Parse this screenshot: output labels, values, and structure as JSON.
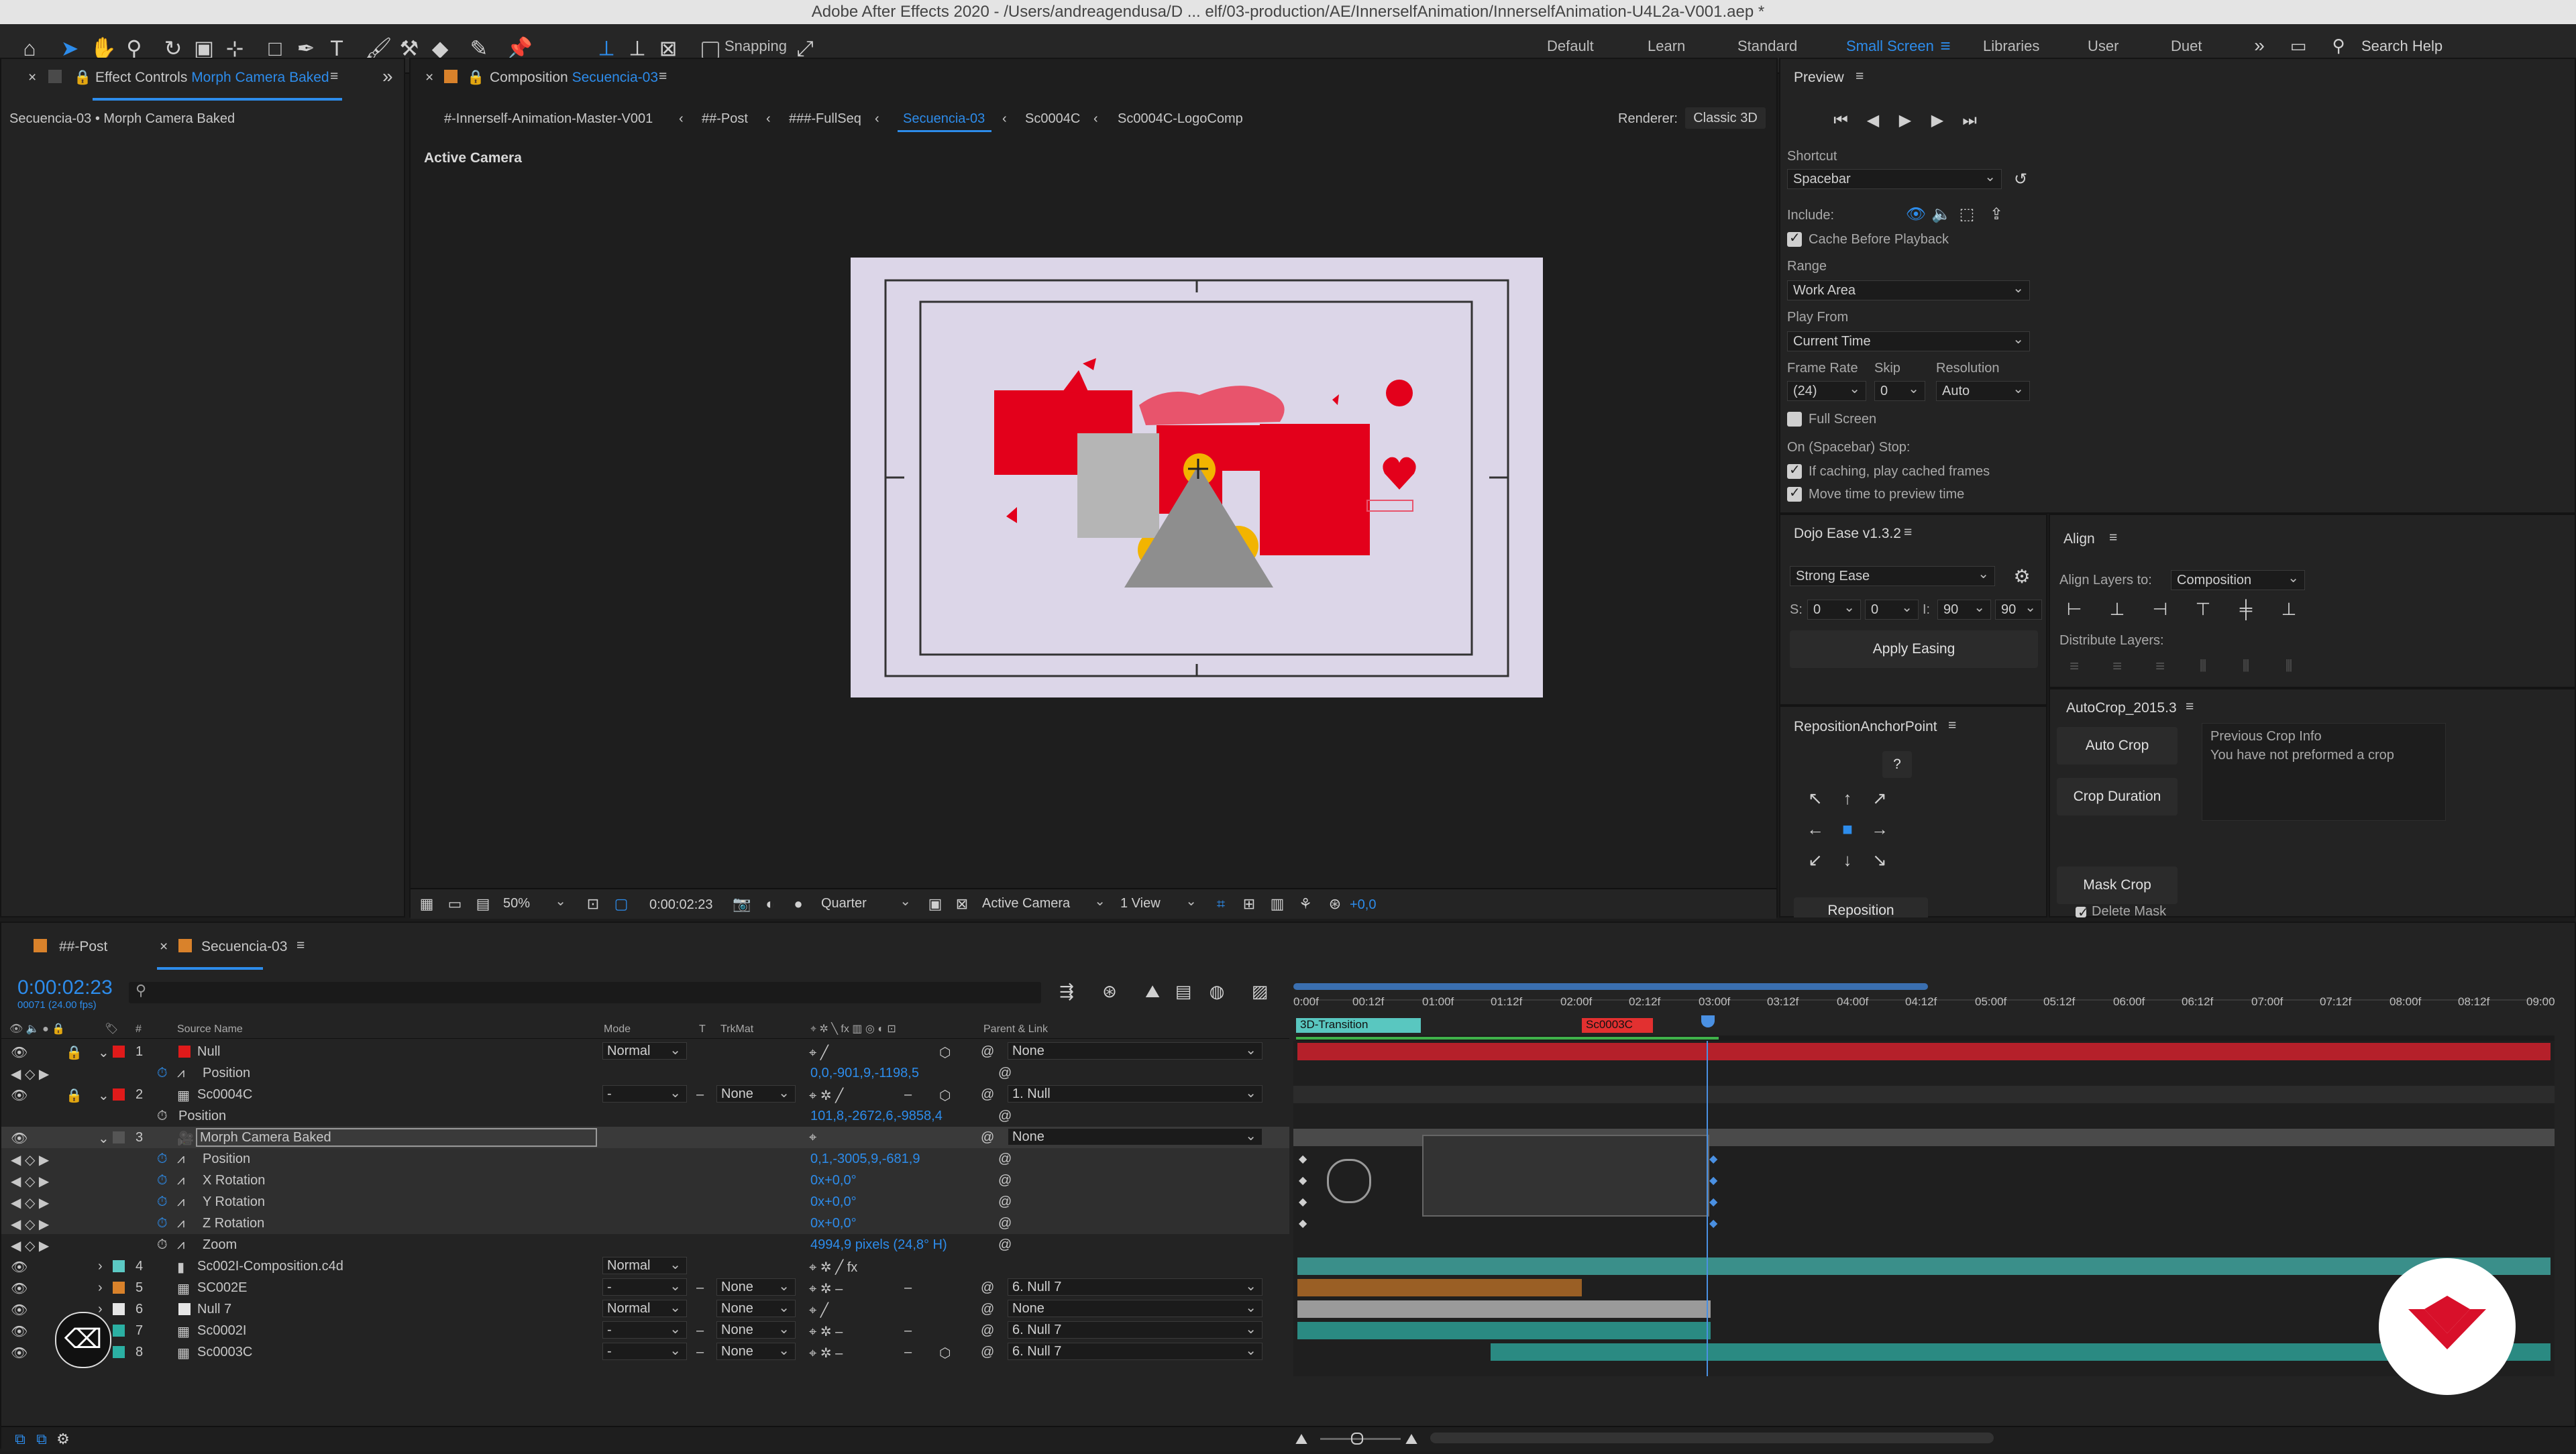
{
  "window_title": "Adobe After Effects 2020 - /Users/andreagendusa/D ... elf/03-production/AE/InnerselfAnimation/InnerselfAnimation-U4L2a-V001.aep *",
  "toolbar": {
    "snapping_label": "Snapping",
    "workspaces": [
      "Default",
      "Learn",
      "Standard",
      "Small Screen",
      "Libraries",
      "User",
      "Duet"
    ],
    "active_workspace": "Small Screen",
    "search_placeholder": "Search Help"
  },
  "effect_controls": {
    "tab_prefix": "Effect Controls",
    "tab_layer": "Morph Camera Baked",
    "subtitle": "Secuencia-03 • Morph Camera Baked"
  },
  "composition": {
    "tab_prefix": "Composition",
    "tab_comp": "Secuencia-03",
    "breadcrumbs": [
      "#-Innerself-Animation-Master-V001",
      "##-Post",
      "###-FullSeq",
      "Secuencia-03",
      "Sc0004C",
      "Sc0004C-LogoComp"
    ],
    "active_breadcrumb": "Secuencia-03",
    "renderer_label": "Renderer:",
    "renderer_value": "Classic 3D",
    "view_label": "Active Camera",
    "footer": {
      "zoom": "50%",
      "timecode": "0:00:02:23",
      "resolution": "Quarter",
      "camera": "Active Camera",
      "views": "1 View",
      "exposure": "+0,0"
    }
  },
  "preview": {
    "title": "Preview",
    "shortcut_label": "Shortcut",
    "shortcut_value": "Spacebar",
    "include_label": "Include:",
    "cache_label": "Cache Before Playback",
    "range_label": "Range",
    "range_value": "Work Area",
    "play_from_label": "Play From",
    "play_from_value": "Current Time",
    "frame_rate_label": "Frame Rate",
    "skip_label": "Skip",
    "resolution_label": "Resolution",
    "frame_rate_value": "(24)",
    "skip_value": "0",
    "resolution_value": "Auto",
    "full_screen_label": "Full Screen",
    "stop_label": "On (Spacebar) Stop:",
    "if_caching_label": "If caching, play cached frames",
    "move_time_label": "Move time to preview time"
  },
  "dojo_ease": {
    "title": "Dojo Ease v1.3.2",
    "preset": "Strong Ease",
    "s_label": "S:",
    "s_values": [
      "0",
      "0"
    ],
    "i_label": "I:",
    "i_values": [
      "90",
      "90"
    ],
    "apply_label": "Apply Easing"
  },
  "align": {
    "title": "Align",
    "align_to_label": "Align Layers to:",
    "align_to_value": "Composition",
    "distribute_label": "Distribute Layers:"
  },
  "reposition": {
    "title": "RepositionAnchorPoint",
    "help": "?",
    "button": "Reposition"
  },
  "autocrop": {
    "title": "AutoCrop_2015.3",
    "auto_crop": "Auto Crop",
    "crop_duration": "Crop Duration",
    "mask_crop": "Mask Crop",
    "delete_mask": "Delete Mask",
    "info_title": "Previous Crop Info",
    "info_text": "You have not preformed a crop"
  },
  "timeline": {
    "tabs": [
      "##-Post",
      "Secuencia-03"
    ],
    "active_tab": "Secuencia-03",
    "timecode": "0:00:02:23",
    "frame_info": "00071 (24.00 fps)",
    "columns": {
      "source": "Source Name",
      "mode": "Mode",
      "t": "T",
      "trkmat": "TrkMat",
      "parent": "Parent & Link",
      "num": "#"
    },
    "ruler": [
      "0:00f",
      "00:12f",
      "01:00f",
      "01:12f",
      "02:00f",
      "02:12f",
      "03:00f",
      "03:12f",
      "04:00f",
      "04:12f",
      "05:00f",
      "05:12f",
      "06:00f",
      "06:12f",
      "07:00f",
      "07:12f",
      "08:00f",
      "08:12f",
      "09:00"
    ],
    "markers": [
      "3D-Transition",
      "Sc0003C"
    ],
    "layers": [
      {
        "num": "1",
        "name": "Null",
        "mode": "Normal",
        "trkmat": "",
        "parent": "None",
        "color": "#e01a1a"
      },
      {
        "prop": "Position",
        "value": "0,0,-901,9,-1198,5"
      },
      {
        "num": "2",
        "name": "Sc0004C",
        "mode": "-",
        "trkmat": "None",
        "parent": "1. Null",
        "color": "#e01a1a"
      },
      {
        "prop": "Position",
        "value": "101,8,-2672,6,-9858,4"
      },
      {
        "num": "3",
        "name": "Morph Camera Baked",
        "mode": "",
        "trkmat": "",
        "parent": "None",
        "color": "#555555"
      },
      {
        "prop": "Position",
        "value": "0,1,-3005,9,-681,9"
      },
      {
        "prop": "X Rotation",
        "value": "0x+0,0°"
      },
      {
        "prop": "Y Rotation",
        "value": "0x+0,0°"
      },
      {
        "prop": "Z Rotation",
        "value": "0x+0,0°"
      },
      {
        "prop": "Zoom",
        "value": "4994,9 pixels (24,8° H)"
      },
      {
        "num": "4",
        "name": "Sc002I-Composition.c4d",
        "mode": "Normal",
        "trkmat": "",
        "parent": "",
        "color": "#5cc9c4"
      },
      {
        "num": "5",
        "name": "SC002E",
        "mode": "-",
        "trkmat": "None",
        "parent": "6. Null 7",
        "color": "#d9822b"
      },
      {
        "num": "6",
        "name": "Null 7",
        "mode": "Normal",
        "trkmat": "None",
        "parent": "None",
        "color": "#e6e6e6"
      },
      {
        "num": "7",
        "name": "Sc0002I",
        "mode": "-",
        "trkmat": "None",
        "parent": "6. Null 7",
        "color": "#2bb0a3"
      },
      {
        "num": "8",
        "name": "Sc0003C",
        "mode": "-",
        "trkmat": "None",
        "parent": "6. Null 7",
        "color": "#2bb0a3"
      }
    ]
  },
  "colors": {
    "accent": "#2d8ceb",
    "playhead": "#4a90e2",
    "null_bar": "#b5202a",
    "teal_bar": "#3a8f8a"
  }
}
